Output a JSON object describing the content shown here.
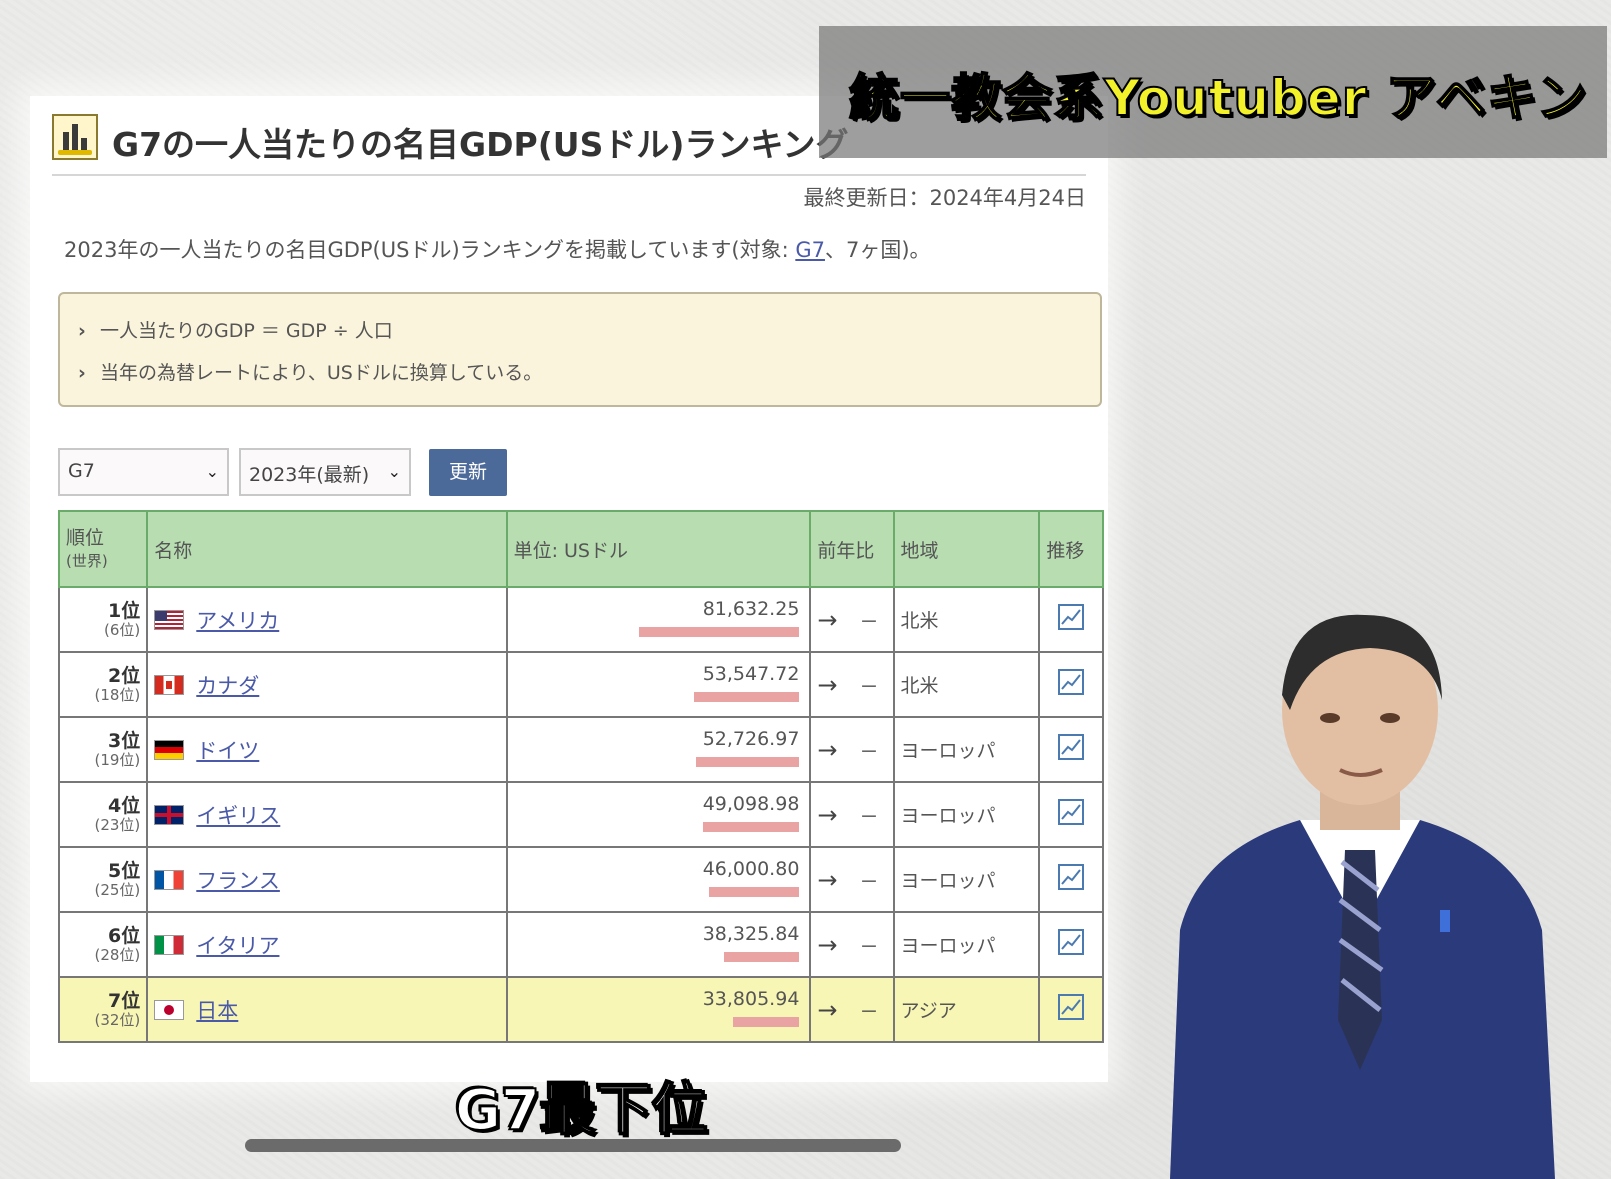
{
  "page": {
    "title": "G7の一人当たりの名目GDP(USドル)ランキング",
    "updated": "最終更新日：2024年4月24日",
    "intro_prefix": "2023年の一人当たりの名目GDP(USドル)ランキングを掲載しています(対象: ",
    "intro_link": "G7",
    "intro_suffix": "、7ヶ国)。",
    "notes": [
      "一人当たりのGDP ＝ GDP ÷ 人口",
      "当年の為替レートにより、USドルに換算している。"
    ]
  },
  "controls": {
    "group_select": "G7",
    "year_select": "2023年(最新)",
    "update_button": "更新"
  },
  "table": {
    "headers": {
      "rank": "順位",
      "rank_sub": "(世界)",
      "name": "名称",
      "unit": "単位: USドル",
      "yoy": "前年比",
      "region": "地域",
      "trend": "推移"
    },
    "max_value": 81632.25,
    "rows": [
      {
        "rank": "1位",
        "world": "(6位)",
        "name": "アメリカ",
        "value": "81,632.25",
        "num": 81632.25,
        "arrow": "→",
        "change": "－",
        "region": "北米",
        "flag": "us"
      },
      {
        "rank": "2位",
        "world": "(18位)",
        "name": "カナダ",
        "value": "53,547.72",
        "num": 53547.72,
        "arrow": "→",
        "change": "－",
        "region": "北米",
        "flag": "ca"
      },
      {
        "rank": "3位",
        "world": "(19位)",
        "name": "ドイツ",
        "value": "52,726.97",
        "num": 52726.97,
        "arrow": "→",
        "change": "－",
        "region": "ヨーロッパ",
        "flag": "de"
      },
      {
        "rank": "4位",
        "world": "(23位)",
        "name": "イギリス",
        "value": "49,098.98",
        "num": 49098.98,
        "arrow": "→",
        "change": "－",
        "region": "ヨーロッパ",
        "flag": "gb"
      },
      {
        "rank": "5位",
        "world": "(25位)",
        "name": "フランス",
        "value": "46,000.80",
        "num": 46000.8,
        "arrow": "→",
        "change": "－",
        "region": "ヨーロッパ",
        "flag": "fr"
      },
      {
        "rank": "6位",
        "world": "(28位)",
        "name": "イタリア",
        "value": "38,325.84",
        "num": 38325.84,
        "arrow": "→",
        "change": "－",
        "region": "ヨーロッパ",
        "flag": "it"
      },
      {
        "rank": "7位",
        "world": "(32位)",
        "name": "日本",
        "value": "33,805.94",
        "num": 33805.94,
        "arrow": "→",
        "change": "－",
        "region": "アジア",
        "flag": "jp"
      }
    ]
  },
  "overlay": {
    "ribbon": "統一教会系Youtuber アベキン",
    "subtitle": "G7最下位"
  }
}
